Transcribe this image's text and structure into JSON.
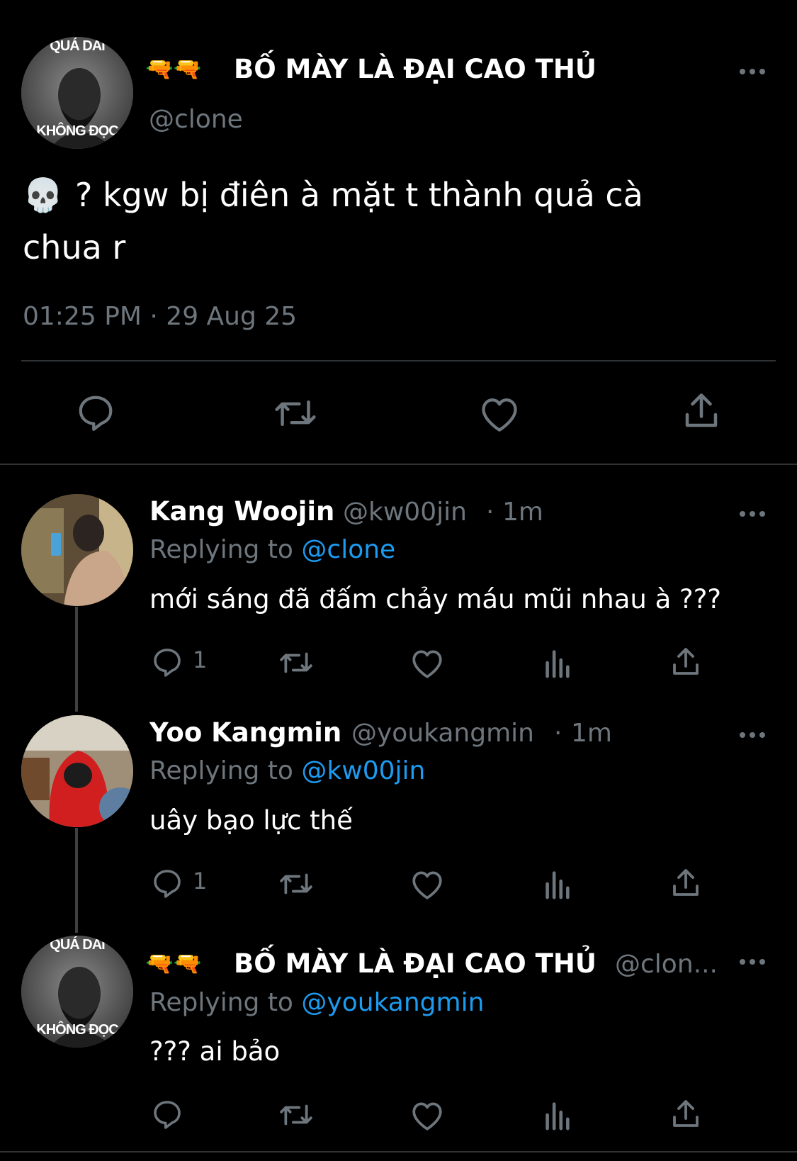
{
  "main_tweet": {
    "display_name": "BỐ MÀY LÀ ĐẠI CAO THỦ",
    "name_emoji": "🔫🔫",
    "handle": "@clone",
    "avatar_caption_top": "QUÁ DAI",
    "avatar_caption_bottom": "KHÔNG ĐỌC",
    "text_emoji": "💀",
    "text_line1": "? kgw bị điên à mặt t thành quả cà",
    "text_line2": "chua r",
    "timestamp": "01:25 PM · 29 Aug 25",
    "actions": [
      "reply-icon",
      "retweet-icon",
      "like-icon",
      "share-icon"
    ]
  },
  "replies": [
    {
      "display_name": "Kang Woojin",
      "handle": "@kw00jin",
      "separator": "·",
      "time": "1m",
      "replying_prefix": "Replying to",
      "replying_to": "@clone",
      "text": "mới sáng đã đấm chảy máu mũi nhau à ???",
      "reply_count": "1"
    },
    {
      "display_name": "Yoo Kangmin",
      "handle": "@youkangmin",
      "separator": "·",
      "time": "1m",
      "replying_prefix": "Replying to",
      "replying_to": "@kw00jin",
      "text": "uây bạo lực thế",
      "reply_count": "1"
    },
    {
      "display_name": "BỐ MÀY LÀ ĐẠI CAO THỦ",
      "name_emoji": "🔫🔫",
      "handle": "@clon...",
      "avatar_caption_top": "QUÁ DAI",
      "avatar_caption_bottom": "KHÔNG ĐỌC",
      "replying_prefix": "Replying to",
      "replying_to": "@youkangmin",
      "text": "??? ai bảo",
      "reply_count": ""
    }
  ],
  "colors": {
    "background": "#000000",
    "text": "#ffffff",
    "muted": "#6e767d",
    "link": "#1d9bf0",
    "divider": "#2f3336",
    "gun_green": "#7ed957"
  }
}
